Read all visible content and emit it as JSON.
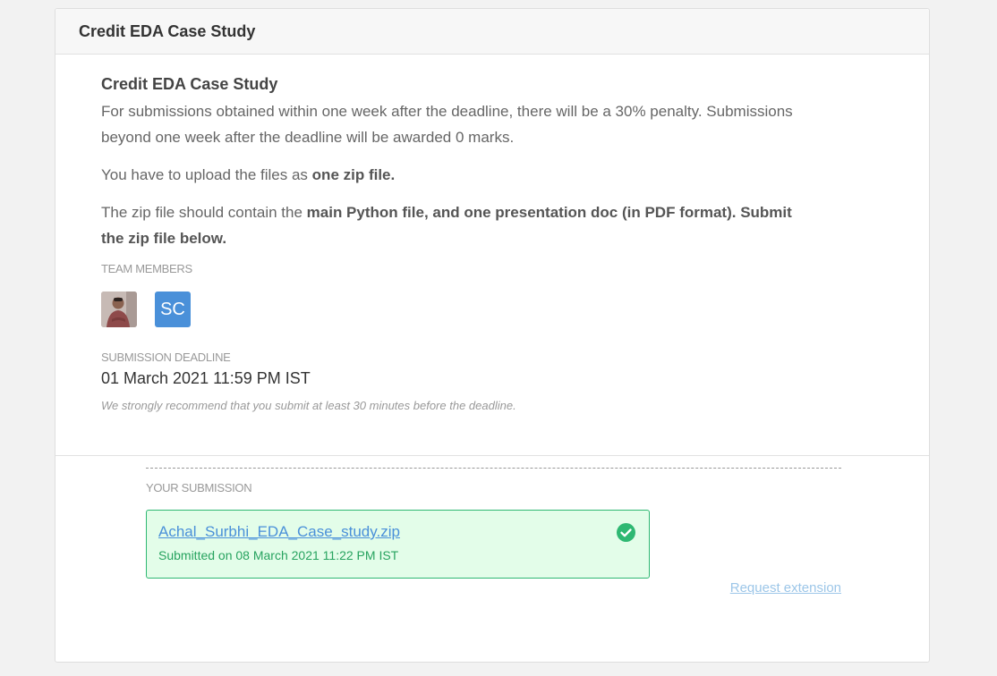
{
  "header": {
    "title": "Credit EDA Case Study"
  },
  "assignment": {
    "title": "Credit EDA Case Study",
    "penalty_text": "For submissions obtained within one week after the deadline, there will be a 30% penalty. Submissions beyond one week after the deadline will be awarded 0 marks.",
    "upload_prefix": "You have to upload the files as ",
    "upload_bold": "one zip file.",
    "contents_prefix": "The zip file should contain the ",
    "contents_bold": "main Python file, and one presentation doc (in PDF format). Submit the zip file below."
  },
  "team": {
    "label": "TEAM MEMBERS",
    "members": [
      {
        "type": "photo",
        "icon": "user-photo-avatar"
      },
      {
        "type": "initials",
        "initials": "SC",
        "color": "#4a90d9"
      }
    ]
  },
  "deadline": {
    "label": "SUBMISSION DEADLINE",
    "value": "01 March 2021 11:59 PM IST",
    "note": "We strongly recommend that you submit at least 30 minutes before the deadline."
  },
  "submission": {
    "label": "YOUR SUBMISSION",
    "file_name": "Achal_Surbhi_EDA_Case_study.zip",
    "submitted_on": "Submitted on 08 March 2021 11:22 PM IST",
    "status_icon": "check-circle-icon",
    "status_color": "#2eb872"
  },
  "actions": {
    "request_extension": "Request extension"
  }
}
